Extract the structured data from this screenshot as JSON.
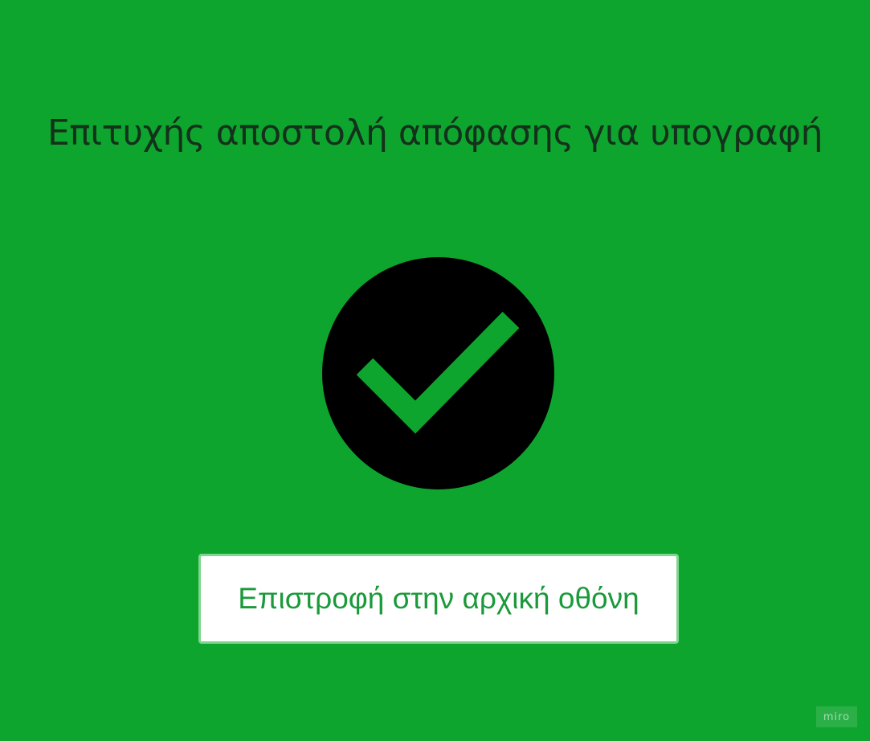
{
  "screen": {
    "title": "Επιτυχής αποστολή απόφασης για υπογραφή",
    "icon": "check-circle-icon",
    "background_color": "#0ea52f",
    "icon_circle_color": "#000000",
    "icon_check_color": "#0ea52f"
  },
  "actions": {
    "home_button_label": "Επιστροφή στην αρχική οθόνη",
    "home_button_text_color": "#1a9a3a"
  },
  "watermark": {
    "text": "miro"
  }
}
